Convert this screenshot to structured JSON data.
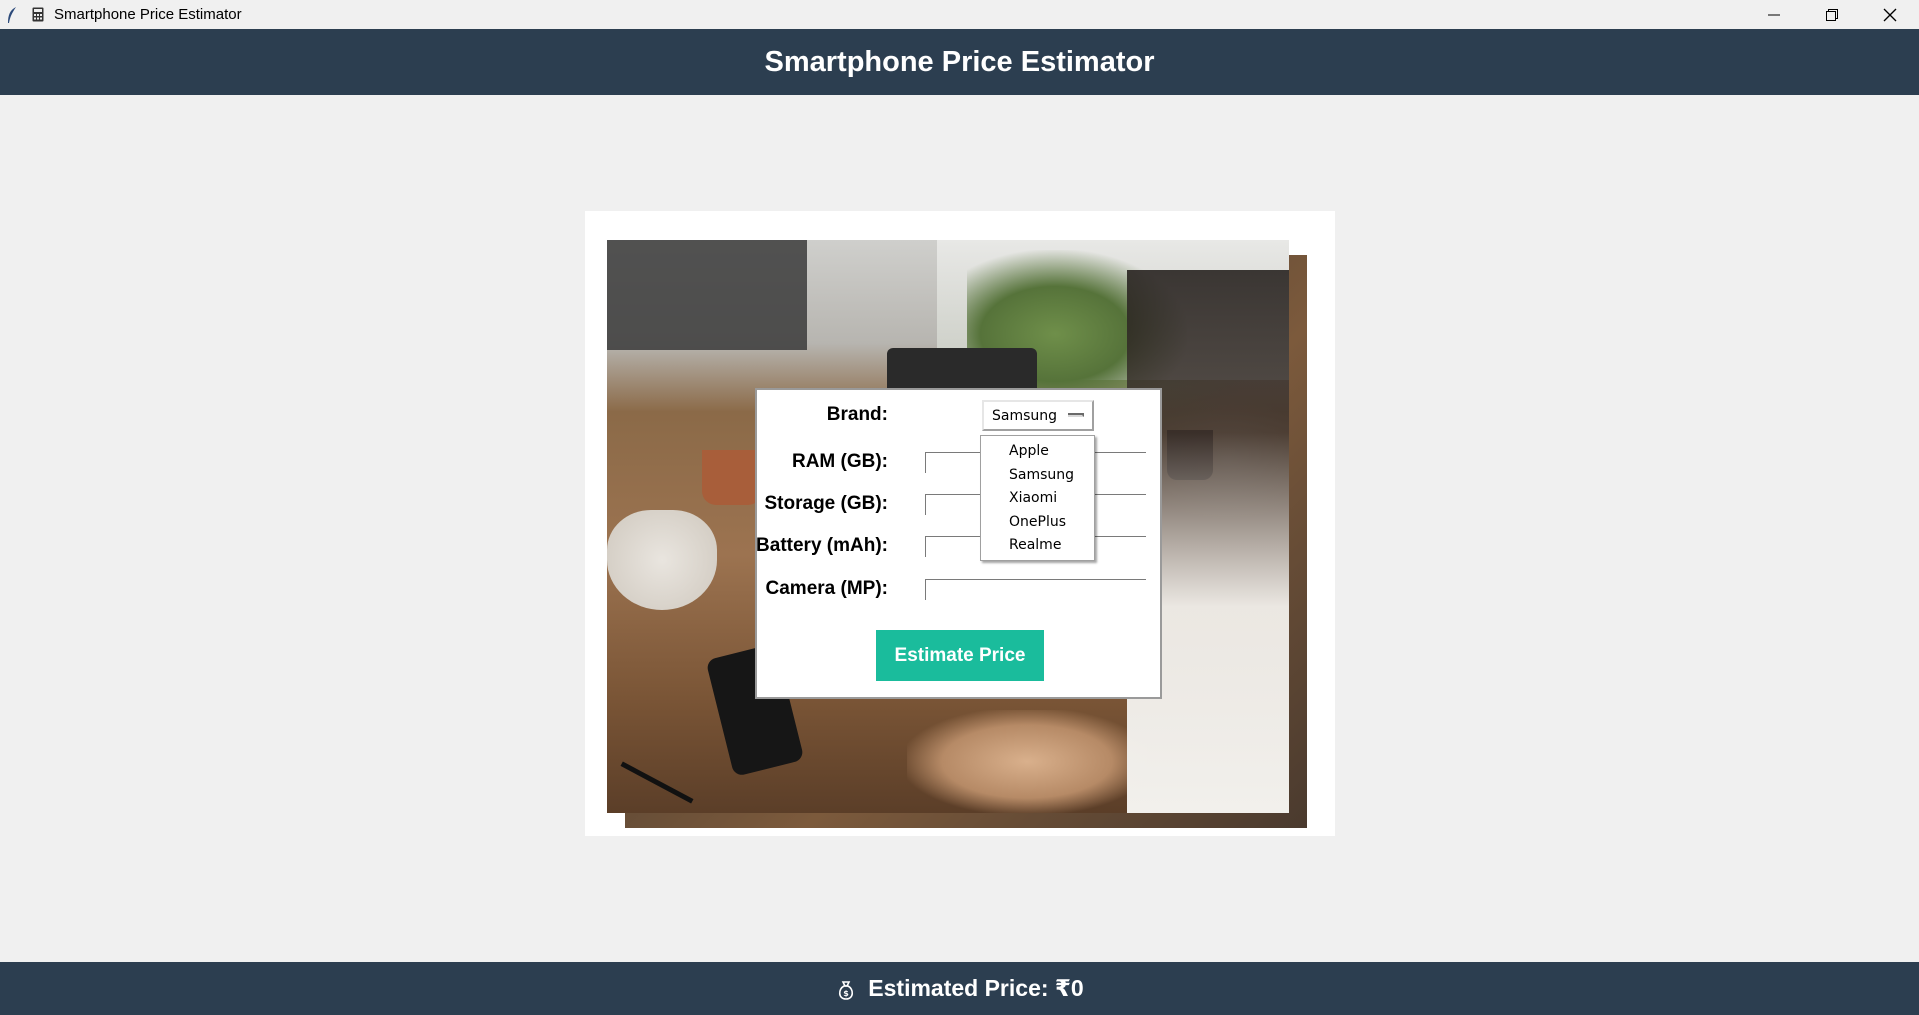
{
  "window": {
    "title": "Smartphone Price Estimator",
    "controls": {
      "minimize": "minimize",
      "restore": "restore",
      "close": "close"
    }
  },
  "header": {
    "title": "Smartphone Price Estimator"
  },
  "form": {
    "brand_label": "Brand:",
    "brand_selected": "Samsung",
    "ram_label": "RAM (GB):",
    "ram_value": "",
    "storage_label": "Storage (GB):",
    "storage_value": "",
    "battery_label": "Battery (mAh):",
    "battery_value": "",
    "camera_label": "Camera (MP):",
    "camera_value": "",
    "estimate_button": "Estimate Price"
  },
  "dropdown": {
    "options": [
      "Apple",
      "Samsung",
      "Xiaomi",
      "OnePlus",
      "Realme"
    ]
  },
  "footer": {
    "result": "Estimated Price: ₹0",
    "icon": "money-bag-icon"
  },
  "colors": {
    "header_bg": "#2c3e50",
    "button_bg": "#1abc9c",
    "page_bg": "#f0f0f0"
  }
}
